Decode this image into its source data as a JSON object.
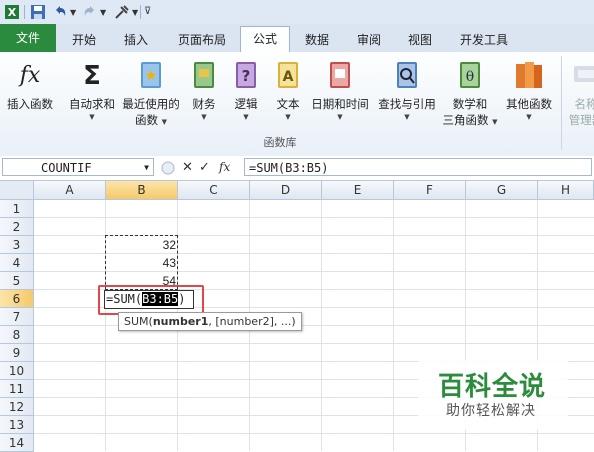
{
  "ribbon_tabs": [
    "文件",
    "开始",
    "插入",
    "页面布局",
    "公式",
    "数据",
    "审阅",
    "视图",
    "开发工具"
  ],
  "ribbon_commands": {
    "insert_function": "插入函数",
    "autosum": "自动求和",
    "recent_line1": "最近使用的",
    "recent_line2": "函数",
    "financial": "财务",
    "logical": "逻辑",
    "text": "文本",
    "datetime": "日期和时间",
    "lookup": "查找与引用",
    "math_line1": "数学和",
    "math_line2": "三角函数",
    "other": "其他函数",
    "names_line1": "名称",
    "names_line2": "管理器",
    "group_label": "函数库"
  },
  "formula_bar": {
    "name_box": "COUNTIF",
    "fx_label": "fx",
    "formula": "=SUM(B3:B5)"
  },
  "columns": [
    "A",
    "B",
    "C",
    "D",
    "E",
    "F",
    "G",
    "H"
  ],
  "rows": [
    "1",
    "2",
    "3",
    "4",
    "5",
    "6",
    "7",
    "8",
    "9",
    "10",
    "11",
    "12",
    "13",
    "14"
  ],
  "cells": {
    "B3": "32",
    "B4": "43",
    "B5": "54"
  },
  "editing": {
    "prefix": "=SUM(",
    "range": "B3:B5",
    "suffix": ")"
  },
  "tooltip": {
    "func": "SUM(",
    "arg1": "number1",
    "rest": ", [number2], ...)"
  },
  "watermark": {
    "title": "百科全说",
    "subtitle": "助你轻松解决"
  },
  "colors": {
    "file_tab": "#2a8a3d",
    "selection_header": "#f6c96b",
    "highlight_box": "#e0464a",
    "watermark_green": "#2b8c3c"
  }
}
